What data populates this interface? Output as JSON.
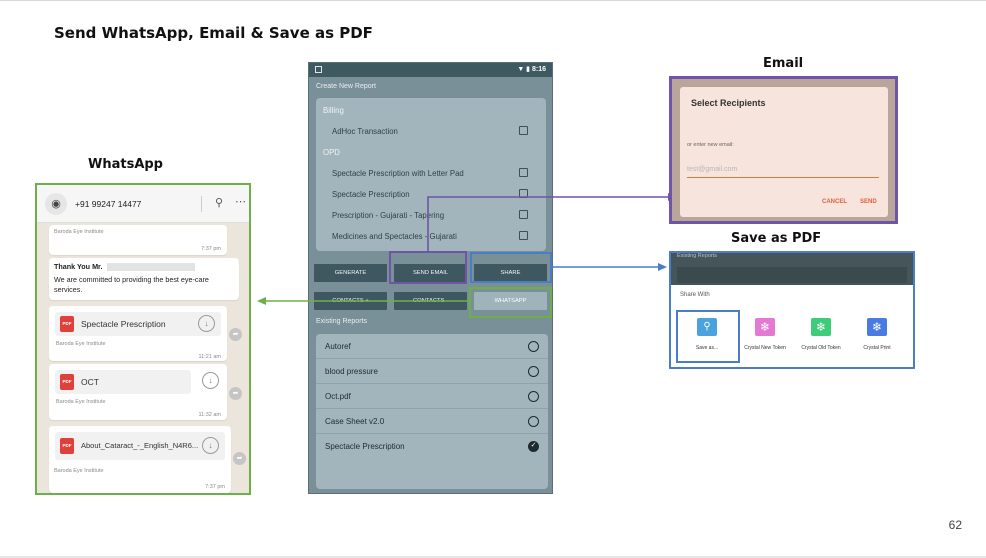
{
  "title": "Send WhatsApp, Email & Save as PDF",
  "page_number": "62",
  "labels": {
    "whatsapp": "WhatsApp",
    "email": "Email",
    "save_pdf": "Save as PDF"
  },
  "colors": {
    "whatsapp_frame": "#6db04a",
    "email_frame": "#6f54a8",
    "pdf_frame": "#4a7ec4"
  },
  "whatsapp": {
    "phone": "+91 99247 14477",
    "search_icon": "search-icon",
    "more_icon": "more-vertical-icon",
    "messages": [
      {
        "sender": "Baroda Eye Institute",
        "time": "7:37 pm"
      },
      {
        "line1": "Thank You Mr.",
        "line2": "We are committed to providing the best eye-care services."
      }
    ],
    "documents": [
      {
        "name": "Spectacle Prescription",
        "sender": "Baroda Eye Institute",
        "time": "11:21 am",
        "icon": "PDF"
      },
      {
        "name": "OCT",
        "sender": "Baroda Eye Institute",
        "time": "11:32 am",
        "icon": "PDF"
      },
      {
        "name": "About_Cataract_-_English_N4R6...",
        "sender": "Baroda Eye Institute",
        "time": "7:37 pm",
        "icon": "PDF"
      }
    ]
  },
  "phone": {
    "status_time": "8:16",
    "create_new_report": "Create New Report",
    "billing": "Billing",
    "adhoc": "AdHoc Transaction",
    "opd": "OPD",
    "opd_items": [
      "Spectacle Prescription with Letter Pad",
      "Spectacle Prescription",
      "Prescription - Gujarati - Tapering",
      "Medicines and Spectacles - Gujarati"
    ],
    "buttons": [
      "GENERATE",
      "SEND EMAIL",
      "SHARE",
      "CONTACTS +",
      "CONTACTS -",
      "WHATSAPP"
    ],
    "existing_reports": "Existing Reports",
    "reports": [
      {
        "name": "Autoref",
        "selected": false
      },
      {
        "name": "blood pressure",
        "selected": false
      },
      {
        "name": "Oct.pdf",
        "selected": false
      },
      {
        "name": "Case Sheet v2.0",
        "selected": false
      },
      {
        "name": "Spectacle Prescription",
        "selected": true
      }
    ]
  },
  "email_dialog": {
    "title": "Select Recipients",
    "hint": "or enter new email:",
    "placeholder": "test@gmail.com",
    "cancel": "CANCEL",
    "send": "SEND"
  },
  "share_sheet": {
    "top_text": "Existing Reports",
    "label": "Share With",
    "targets": [
      "Save as...",
      "Crystal New Token",
      "Crystal Old Token",
      "Crystal Print"
    ]
  }
}
